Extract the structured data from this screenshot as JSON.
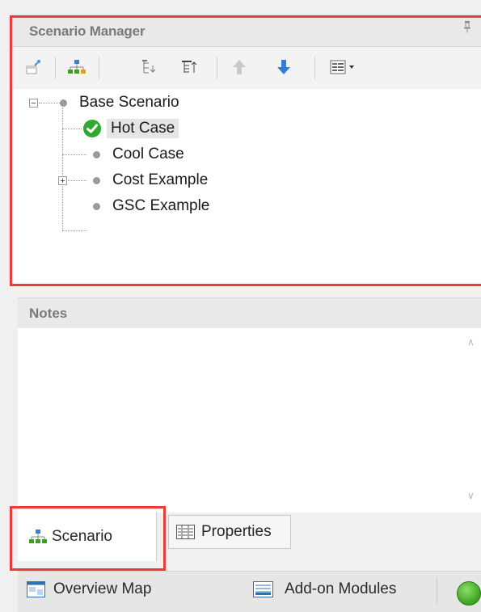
{
  "scenario_manager": {
    "title": "Scenario Manager",
    "pin_glyph": "↕",
    "toolbar_icons": [
      "new-scenario-icon",
      "hierarchy-icon",
      "collapse-tree-icon",
      "sort-tree-icon",
      "move-up-icon",
      "move-down-icon",
      "view-options-icon"
    ],
    "tree": {
      "root": {
        "label": "Base Scenario",
        "expander": "−"
      },
      "children": [
        {
          "label": "Hot Case",
          "selected": true,
          "status": "active"
        },
        {
          "label": "Cool Case"
        },
        {
          "label": "Cost Example",
          "expander": "+"
        },
        {
          "label": "GSC Example"
        }
      ]
    }
  },
  "notes": {
    "title": "Notes",
    "value": "",
    "scroll_up": "∧",
    "scroll_down": "∨"
  },
  "tabs": [
    {
      "label": "Scenario",
      "icon": "scenario-tree-icon",
      "active": true
    },
    {
      "label": "Properties",
      "icon": "properties-grid-icon",
      "active": false
    }
  ],
  "status_bar": {
    "overview_map": "Overview Map",
    "add_on_modules": "Add-on Modules",
    "indicator_color": "#3aa21f"
  },
  "colors": {
    "highlight": "#ed3b3b",
    "arrow_up": "#c8c8c8",
    "arrow_down": "#2f7fd8"
  }
}
